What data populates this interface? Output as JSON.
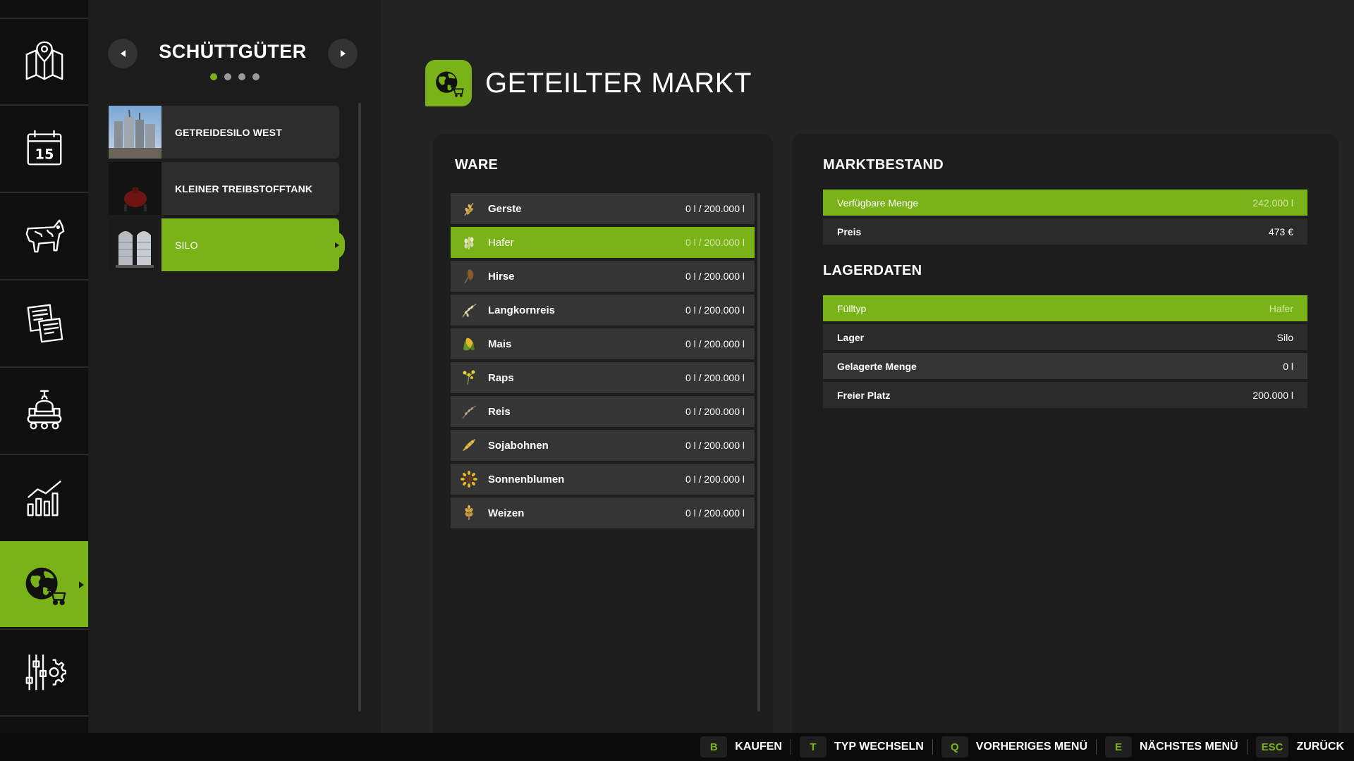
{
  "rail": {
    "items": [
      {
        "icon": "map-icon"
      },
      {
        "icon": "calendar-icon",
        "badge": "15"
      },
      {
        "icon": "cow-icon"
      },
      {
        "icon": "contracts-icon"
      },
      {
        "icon": "production-icon"
      },
      {
        "icon": "statistics-icon"
      },
      {
        "icon": "global-market-icon",
        "active": true
      },
      {
        "icon": "settings-icon"
      }
    ]
  },
  "storage": {
    "title": "SCHÜTTGÜTER",
    "page_count": 4,
    "active_page": 1,
    "items": [
      {
        "label": "GETREIDESILO WEST",
        "thumb": "grain-silo-thumb"
      },
      {
        "label": "KLEINER TREIBSTOFFTANK",
        "thumb": "fuel-tank-thumb"
      },
      {
        "label": "SILO",
        "thumb": "silo-thumb",
        "active": true
      }
    ]
  },
  "main": {
    "title": "GETEILTER MARKT",
    "title_icon": "globe-cart-icon"
  },
  "ware": {
    "heading": "WARE",
    "rows": [
      {
        "name": "Gerste",
        "value": "0 l / 200.000 l",
        "icon": "barley-icon"
      },
      {
        "name": "Hafer",
        "value": "0 l / 200.000 l",
        "icon": "oat-icon",
        "active": true
      },
      {
        "name": "Hirse",
        "value": "0 l / 200.000 l",
        "icon": "sorghum-icon"
      },
      {
        "name": "Langkornreis",
        "value": "0 l / 200.000 l",
        "icon": "longgrain-rice-icon"
      },
      {
        "name": "Mais",
        "value": "0 l / 200.000 l",
        "icon": "maize-icon"
      },
      {
        "name": "Raps",
        "value": "0 l / 200.000 l",
        "icon": "canola-icon"
      },
      {
        "name": "Reis",
        "value": "0 l / 200.000 l",
        "icon": "rice-icon"
      },
      {
        "name": "Sojabohnen",
        "value": "0 l / 200.000 l",
        "icon": "soybean-icon"
      },
      {
        "name": "Sonnenblumen",
        "value": "0 l / 200.000 l",
        "icon": "sunflower-icon"
      },
      {
        "name": "Weizen",
        "value": "0 l / 200.000 l",
        "icon": "wheat-icon"
      }
    ]
  },
  "marktbestand": {
    "heading": "MARKTBESTAND",
    "rows": [
      {
        "key": "Verfügbare Menge",
        "value": "242.000 l"
      },
      {
        "key": "Preis",
        "value": "473 €"
      }
    ]
  },
  "lagerdaten": {
    "heading": "LAGERDATEN",
    "rows": [
      {
        "key": "Fülltyp",
        "value": "Hafer"
      },
      {
        "key": "Lager",
        "value": "Silo"
      },
      {
        "key": "Gelagerte Menge",
        "value": "0 l"
      },
      {
        "key": "Freier Platz",
        "value": "200.000 l"
      }
    ]
  },
  "hints": [
    {
      "key": "B",
      "label": "KAUFEN"
    },
    {
      "key": "T",
      "label": "TYP WECHSELN"
    },
    {
      "key": "Q",
      "label": "VORHERIGES MENÜ"
    },
    {
      "key": "E",
      "label": "NÄCHSTES MENÜ"
    },
    {
      "key": "ESC",
      "label": "ZURÜCK"
    }
  ],
  "colors": {
    "accent": "#7ab317",
    "background": "#232323",
    "rail": "#0f0f0f",
    "row": "#353535"
  }
}
